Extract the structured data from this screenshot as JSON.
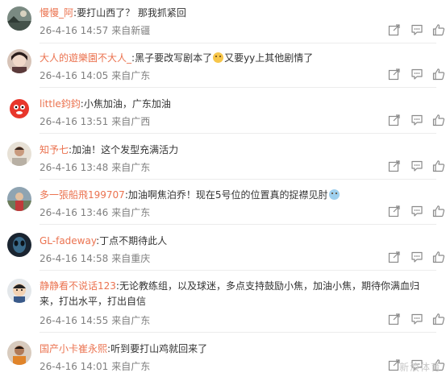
{
  "comments": [
    {
      "user": "慢慢_阿",
      "segments": [
        {
          "t": "要打山西了？ 那我抓紧回"
        }
      ],
      "date": "26-4-16 14:57",
      "source": "来自新疆"
    },
    {
      "user": "大人的遊樂園不大人_",
      "segments": [
        {
          "t": "黑子要改写剧本了"
        },
        {
          "e": "laugh"
        },
        {
          "t": "又要yy上其他剧情了"
        }
      ],
      "date": "26-4-16 14:05",
      "source": "来自广东"
    },
    {
      "user": "little鈞鈞",
      "segments": [
        {
          "t": "小焦加油，广东加油"
        }
      ],
      "date": "26-4-16 13:51",
      "source": "来自广西"
    },
    {
      "user": "知予七",
      "segments": [
        {
          "t": "加油！这个发型充满活力"
        }
      ],
      "date": "26-4-16 13:48",
      "source": "来自广东"
    },
    {
      "user": "多一張船飛199707",
      "segments": [
        {
          "t": "加油啊焦泊乔！现在5号位的位置真的捉襟见肘"
        },
        {
          "e": "cry"
        }
      ],
      "date": "26-4-16 13:46",
      "source": "来自广东"
    },
    {
      "user": "GL-fadeway",
      "segments": [
        {
          "t": "丁点不期待此人"
        }
      ],
      "date": "26-4-16 14:58",
      "source": "来自重庆"
    },
    {
      "user": "静静看不说话123",
      "segments": [
        {
          "t": "无论教练组，以及球迷，多点支持鼓励小焦，加油小焦，期待你满血归来，打出水平，打出自信"
        }
      ],
      "date": "26-4-16 14:55",
      "source": "来自广东"
    },
    {
      "user": "国产小卡崔永熙",
      "segments": [
        {
          "t": "听到要打山鸡就回来了"
        }
      ],
      "date": "26-4-16 14:01",
      "source": "来自广东"
    }
  ],
  "colon": ":",
  "watermark": "新浪体育",
  "icons": {
    "share": "share-icon",
    "reply": "comment-icon",
    "like": "thumbs-up-icon"
  },
  "colors": {
    "username": "#eb7350",
    "meta": "#808080",
    "text": "#333333",
    "icon": "#8a8a8a"
  }
}
